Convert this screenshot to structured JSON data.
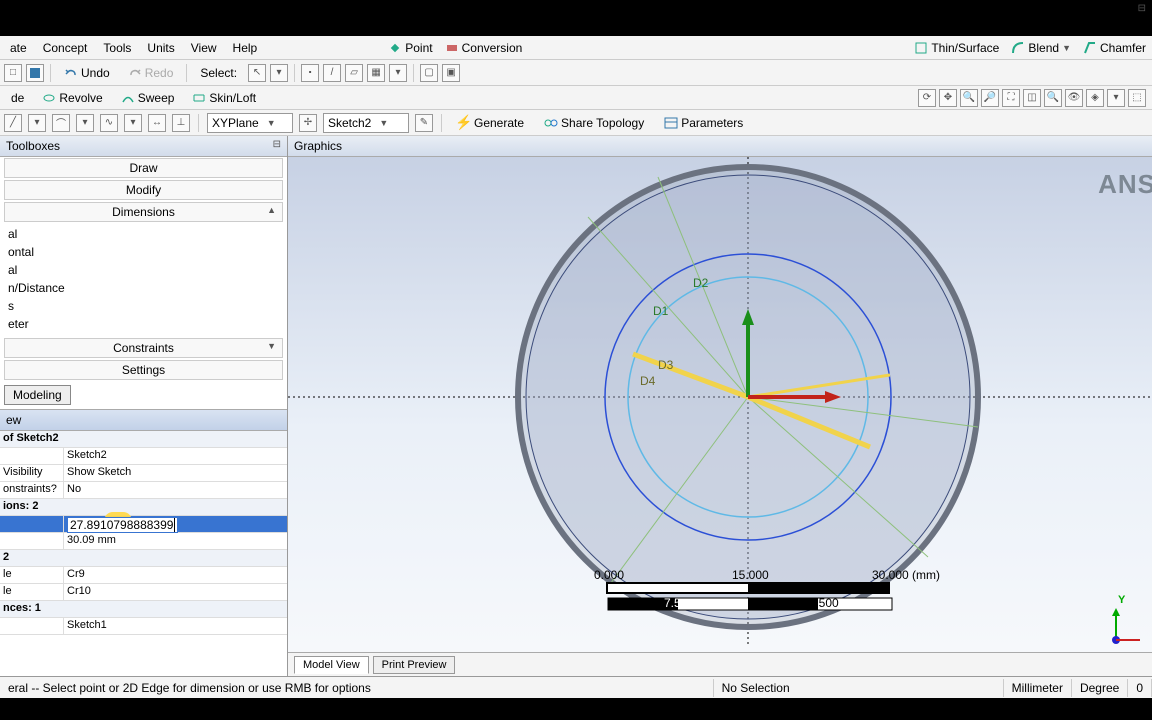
{
  "menubar": {
    "items": [
      "ate",
      "Concept",
      "Tools",
      "Units",
      "View",
      "Help"
    ],
    "right": {
      "point": "Point",
      "conversion": "Conversion",
      "thin": "Thin/Surface",
      "blend": "Blend",
      "chamfer": "Chamfer"
    }
  },
  "toolbar1": {
    "undo": "Undo",
    "redo": "Redo",
    "select": "Select:"
  },
  "toolbar2": {
    "de": "de",
    "revolve": "Revolve",
    "sweep": "Sweep",
    "skinloft": "Skin/Loft"
  },
  "sketchbar": {
    "plane": "XYPlane",
    "sketch": "Sketch2",
    "generate": "Generate",
    "share": "Share Topology",
    "params": "Parameters"
  },
  "left": {
    "panel_title": "Toolboxes",
    "draw": "Draw",
    "modify": "Modify",
    "dimensions": "Dimensions",
    "dim_items": [
      "al",
      "ontal",
      "al",
      "n/Distance",
      "s",
      "eter"
    ],
    "constraints": "Constraints",
    "settings": "Settings",
    "modeling": "Modeling",
    "details_title": "ew",
    "section": "of Sketch2",
    "rows": [
      {
        "k": "",
        "v": "Sketch2"
      },
      {
        "k": "Visibility",
        "v": "Show Sketch"
      },
      {
        "k": "onstraints?",
        "v": "No"
      }
    ],
    "ions_head": "ions: 2",
    "edit_value": "27.8910798888399",
    "d4_value": "30.09 mm",
    "two_head": "2",
    "cr_rows": [
      {
        "k": "le",
        "v": "Cr9"
      },
      {
        "k": "le",
        "v": "Cr10"
      }
    ],
    "refs_head": "nces: 1",
    "ref_val": "Sketch1"
  },
  "graphics": {
    "title": "Graphics",
    "watermark": "ANS",
    "labels": {
      "d1": "D1",
      "d2": "D2",
      "d3": "D3",
      "d4": "D4"
    },
    "ruler": {
      "t0": "0.000",
      "t1": "15.000",
      "t2": "30.000",
      "unit": "(mm)",
      "s1": "7.500",
      "s2": "22.500"
    },
    "tabs": {
      "model": "Model View",
      "print": "Print Preview"
    },
    "triad_y": "Y"
  },
  "status": {
    "msg": "eral -- Select point or 2D Edge for dimension or use RMB for options",
    "sel": "No Selection",
    "u1": "Millimeter",
    "u2": "Degree",
    "n": "0"
  }
}
